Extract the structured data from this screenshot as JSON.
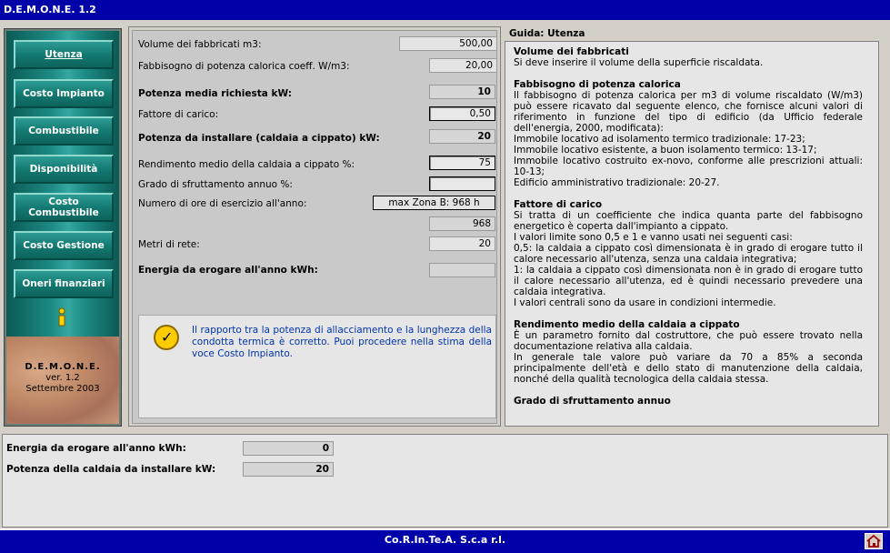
{
  "app": {
    "title": "D.E.M.O.N.E. 1.2"
  },
  "nav": {
    "items": [
      {
        "label": "Utenza",
        "active": true
      },
      {
        "label": "Costo Impianto"
      },
      {
        "label": "Combustibile"
      },
      {
        "label": "Disponibilità"
      },
      {
        "label": "Costo Combustibile"
      },
      {
        "label": "Costo Gestione"
      },
      {
        "label": "Oneri finanziari"
      }
    ],
    "logo": {
      "name": "D.E.M.O.N.E.",
      "version": "ver. 1.2",
      "date": "Settembre 2003"
    }
  },
  "form": {
    "volume": {
      "label": "Volume dei fabbricati m3:",
      "value": "500,00"
    },
    "fabbisogno": {
      "label": "Fabbisogno di potenza calorica coeff. W/m3:",
      "value": "20,00"
    },
    "potenza_media": {
      "label": "Potenza media richiesta kW:",
      "value": "10"
    },
    "fattore_carico": {
      "label": "Fattore di carico:",
      "value": "0,50"
    },
    "potenza_installare": {
      "label": "Potenza da installare (caldaia a cippato) kW:",
      "value": "20"
    },
    "rendimento": {
      "label": "Rendimento medio della caldaia a cippato %:",
      "value": "75"
    },
    "grado_sfruttamento": {
      "label": "Grado di sfruttamento annuo %:",
      "value": ""
    },
    "ore_esercizio": {
      "label": "Numero di ore di esercizio all'anno:",
      "button": "max Zona B: 968 h",
      "value": "968"
    },
    "metri_rete": {
      "label": "Metri di rete:",
      "value": "20"
    },
    "energia_erogare": {
      "label": "Energia da erogare all'anno kWh:",
      "value": ""
    },
    "message": "Il rapporto tra la potenza di allacciamento e la lunghezza della condotta termica è corretto. Puoi procedere nella stima della voce Costo Impianto."
  },
  "guide": {
    "header": "Guida: Utenza",
    "sections": [
      {
        "title": "Volume dei fabbricati",
        "text": "Si deve inserire il volume della superficie riscaldata."
      },
      {
        "title": "Fabbisogno di potenza calorica",
        "text": "Il fabbisogno di potenza calorica per m3 di volume riscaldato (W/m3) può essere ricavato dal seguente elenco, che fornisce alcuni valori di riferimento in funzione del tipo di edificio (da Ufficio federale dell'energia, 2000, modificata):",
        "lines": [
          "Immobile locativo ad isolamento termico tradizionale: 17-23;",
          "Immobile locativo esistente, a buon isolamento termico: 13-17;",
          "Immobile locativo costruito ex-novo, conforme alle prescrizioni attuali: 10-13;",
          "Edificio amministrativo tradizionale: 20-27."
        ]
      },
      {
        "title": "Fattore di carico",
        "text": "Si tratta di un coefficiente che indica quanta parte del fabbisogno energetico è coperta dall'impianto a cippato.",
        "lines": [
          "I valori limite sono 0,5 e 1 e vanno usati nei seguenti casi:",
          "0,5: la caldaia a cippato così dimensionata è in grado di erogare tutto il calore necessario all'utenza, senza una caldaia integrativa;",
          "1: la caldaia a cippato così dimensionata non è in grado di erogare tutto il calore necessario all'utenza, ed è quindi necessario prevedere una caldaia integrativa.",
          "I valori centrali sono da usare in condizioni intermedie."
        ]
      },
      {
        "title": "Rendimento medio della caldaia a cippato",
        "text": "È un parametro fornito dal costruttore, che può essere trovato nella documentazione relativa alla caldaia.",
        "lines": [
          "In generale tale valore può variare da 70 a 85% a seconda principalmente dell'età e dello stato di manutenzione della caldaia, nonché della qualità tecnologica della caldaia stessa."
        ]
      },
      {
        "title": "Grado di sfruttamento annuo",
        "text": ""
      }
    ]
  },
  "bottom": {
    "energia": {
      "label": "Energia da erogare all'anno kWh:",
      "value": "0"
    },
    "potenza": {
      "label": "Potenza della caldaia da installare kW:",
      "value": "20"
    }
  },
  "footer": {
    "text": "Co.R.In.Te.A. S.c.a r.l."
  }
}
